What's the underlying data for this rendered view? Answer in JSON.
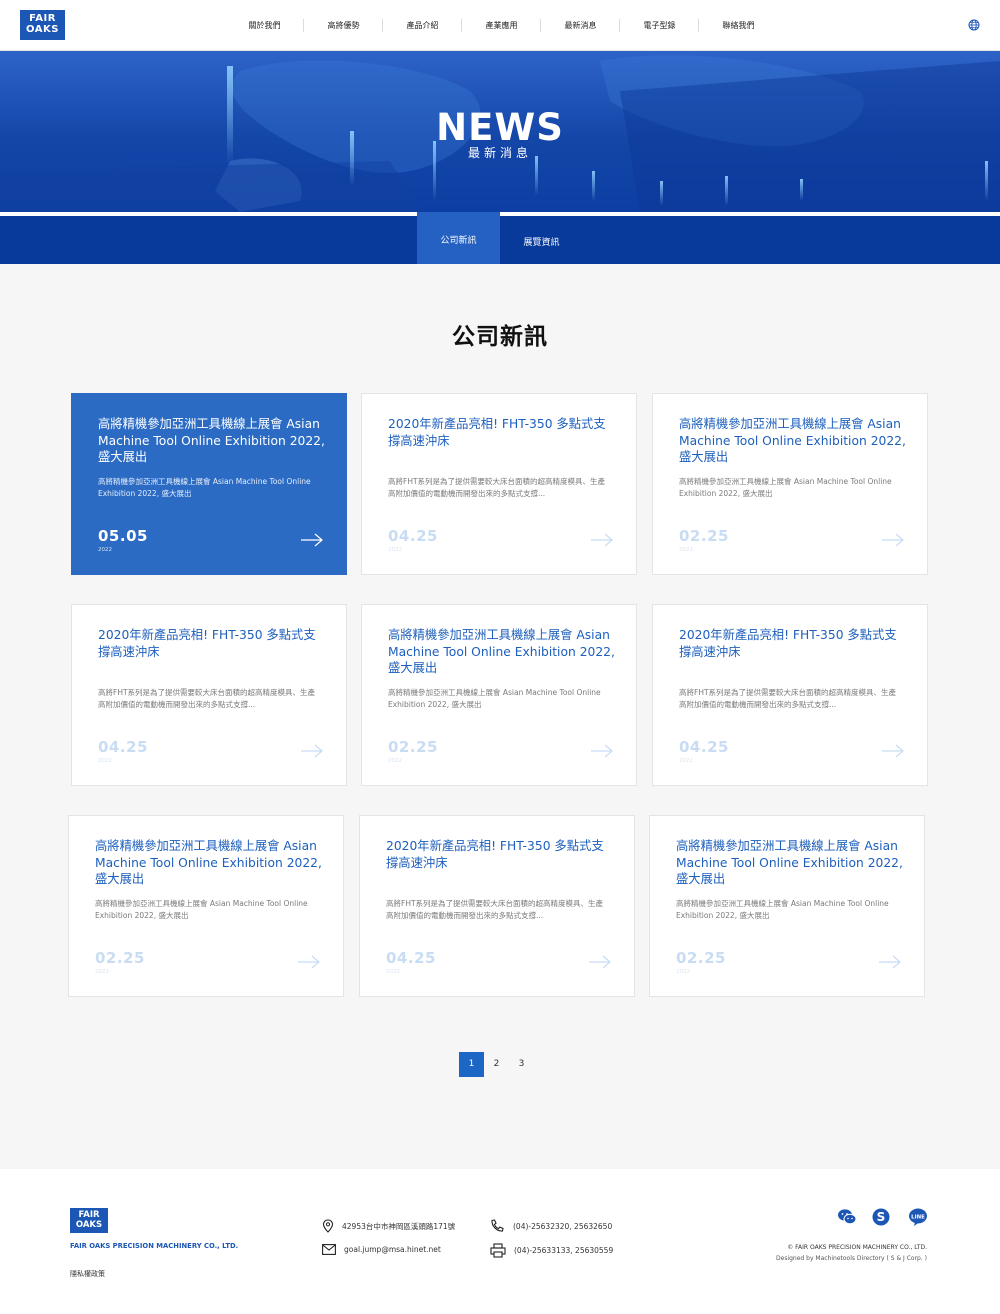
{
  "header": {
    "logo_text": "FAIR OAKS",
    "nav": [
      "關於我們",
      "高將優勢",
      "產品介紹",
      "產業應用",
      "最新消息",
      "電子型錄",
      "聯絡我們"
    ],
    "language_icon": "globe-icon"
  },
  "banner": {
    "title": "NEWS",
    "subtitle": "最新消息"
  },
  "subnav": {
    "tabs": [
      "公司新訊",
      "展覽資訊"
    ],
    "active": "公司新訊"
  },
  "section": {
    "title": "公司新訊"
  },
  "cards": [
    {
      "title": "高將精機參加亞洲工具機線上展會 Asian Machine Tool Online Exhibition 2022, 盛大展出",
      "desc": "高將精機參加亞洲工具機線上展會 Asian Machine Tool Online Exhibition 2022, 盛大展出",
      "date": "05.05",
      "year": "2022",
      "featured": true
    },
    {
      "title": "2020年新產品亮相! FHT-350 多點式支撐高速沖床",
      "desc": "高將FHT系列是為了提供需要較大床台面積的超高精度模具、生產高附加價值的電動機而開發出來的多點式支撐...",
      "date": "04.25",
      "year": "2022",
      "featured": false
    },
    {
      "title": "高將精機參加亞洲工具機線上展會 Asian Machine Tool Online Exhibition 2022, 盛大展出",
      "desc": "高將精機參加亞洲工具機線上展會 Asian Machine Tool Online Exhibition 2022, 盛大展出",
      "date": "02.25",
      "year": "2022",
      "featured": false
    },
    {
      "title": "2020年新產品亮相! FHT-350 多點式支撐高速沖床",
      "desc": "高將FHT系列是為了提供需要較大床台面積的超高精度模具、生產高附加價值的電動機而開發出來的多點式支撐...",
      "date": "04.25",
      "year": "2022",
      "featured": false
    },
    {
      "title": "高將精機參加亞洲工具機線上展會 Asian Machine Tool Online Exhibition 2022, 盛大展出",
      "desc": "高將精機參加亞洲工具機線上展會 Asian Machine Tool Online Exhibition 2022, 盛大展出",
      "date": "02.25",
      "year": "2022",
      "featured": false
    },
    {
      "title": "2020年新產品亮相! FHT-350 多點式支撐高速沖床",
      "desc": "高將FHT系列是為了提供需要較大床台面積的超高精度模具、生產高附加價值的電動機而開發出來的多點式支撐...",
      "date": "04.25",
      "year": "2022",
      "featured": false
    },
    {
      "title": "高將精機參加亞洲工具機線上展會 Asian Machine Tool Online Exhibition 2022, 盛大展出",
      "desc": "高將精機參加亞洲工具機線上展會 Asian Machine Tool Online Exhibition 2022, 盛大展出",
      "date": "02.25",
      "year": "2022",
      "featured": false
    },
    {
      "title": "2020年新產品亮相! FHT-350 多點式支撐高速沖床",
      "desc": "高將FHT系列是為了提供需要較大床台面積的超高精度模具、生產高附加價值的電動機而開發出來的多點式支撐...",
      "date": "04.25",
      "year": "2022",
      "featured": false
    },
    {
      "title": "高將精機參加亞洲工具機線上展會 Asian Machine Tool Online Exhibition 2022, 盛大展出",
      "desc": "高將精機參加亞洲工具機線上展會 Asian Machine Tool Online Exhibition 2022, 盛大展出",
      "date": "02.25",
      "year": "2022",
      "featured": false
    }
  ],
  "pagination": {
    "pages": [
      "1",
      "2",
      "3"
    ],
    "current": "1"
  },
  "footer": {
    "logo_text": "FAIR OAKS",
    "company": "FAIR OAKS PRECISION MACHINERY CO., LTD.",
    "privacy": "隱私權政策",
    "address": "42953台中市神岡區溪頭路171號",
    "email": "goal.jump@msa.hinet.net",
    "phone": "(04)-25632320, 25632650",
    "fax": "(04)-25633133, 25630559",
    "social_icons": [
      "wechat-icon",
      "skype-icon",
      "line-icon"
    ],
    "line_label": "LINE",
    "copyright": "© FAIR OAKS PRECISION MACHINERY CO., LTD.",
    "designer": "Designed by Machinetools Directory ( S & J Corp. )"
  },
  "colors": {
    "brand": "#1d57b6",
    "featured_card": "#2b6bc4",
    "subnav": "#073a9a",
    "pagination_active": "#1c66c6"
  }
}
